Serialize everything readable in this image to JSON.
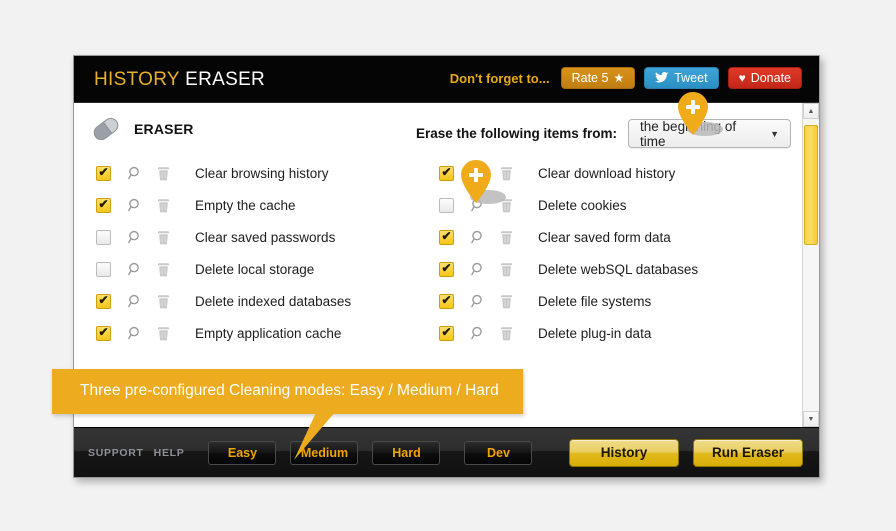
{
  "app": {
    "brand_primary": "HISTORY",
    "brand_secondary": "ERASER",
    "accent_color": "#edab1f",
    "header_bg": "#050505"
  },
  "header": {
    "dont_forget_label": "Don't forget to...",
    "buttons": [
      {
        "id": "rate",
        "label": "Rate 5",
        "icon": "star-icon",
        "glyph": "★",
        "color": "#c07d12"
      },
      {
        "id": "tweet",
        "label": "Tweet",
        "icon": "twitter-bird-icon",
        "glyph": "🐦",
        "color": "#2b8fc4"
      },
      {
        "id": "donate",
        "label": "Donate",
        "icon": "heart-icon",
        "glyph": "♥",
        "color": "#c32717"
      }
    ]
  },
  "main": {
    "section_icon": "eraser-icon",
    "section_label": "ERASER",
    "erase_from_label": "Erase the following items from:",
    "timerange": {
      "selected": "the beginning of time",
      "caret_icon": "chevron-down-icon"
    },
    "row_icons": {
      "search": "magnifier-icon",
      "trash": "trash-icon",
      "checkbox": "checkbox-icon"
    },
    "left_column": [
      {
        "label": "Clear browsing history",
        "checked": true
      },
      {
        "label": "Empty the cache",
        "checked": true
      },
      {
        "label": "Clear saved passwords",
        "checked": false
      },
      {
        "label": "Delete local storage",
        "checked": false
      },
      {
        "label": "Delete indexed databases",
        "checked": true
      },
      {
        "label": "Empty application cache",
        "checked": true
      }
    ],
    "right_column": [
      {
        "label": "Clear download history",
        "checked": true
      },
      {
        "label": "Delete cookies",
        "checked": false
      },
      {
        "label": "Clear saved form data",
        "checked": true
      },
      {
        "label": "Delete webSQL databases",
        "checked": true
      },
      {
        "label": "Delete file systems",
        "checked": true
      },
      {
        "label": "Delete plug-in data",
        "checked": true
      }
    ],
    "scrollbar": {
      "up_icon": "scroll-up-arrow-icon",
      "down_icon": "scroll-down-arrow-icon",
      "thumb_color": "#f7d24a"
    }
  },
  "callouts": {
    "pin_glyph": "+",
    "tooltip_text": "Three pre-configured Cleaning modes: Easy / Medium / Hard"
  },
  "footer": {
    "links": [
      {
        "label": "SUPPORT"
      },
      {
        "label": "HELP"
      }
    ],
    "modes": [
      {
        "label": "Easy"
      },
      {
        "label": "Medium"
      },
      {
        "label": "Hard"
      },
      {
        "label": "Dev"
      }
    ],
    "actions": [
      {
        "label": "History"
      },
      {
        "label": "Run Eraser"
      }
    ]
  }
}
